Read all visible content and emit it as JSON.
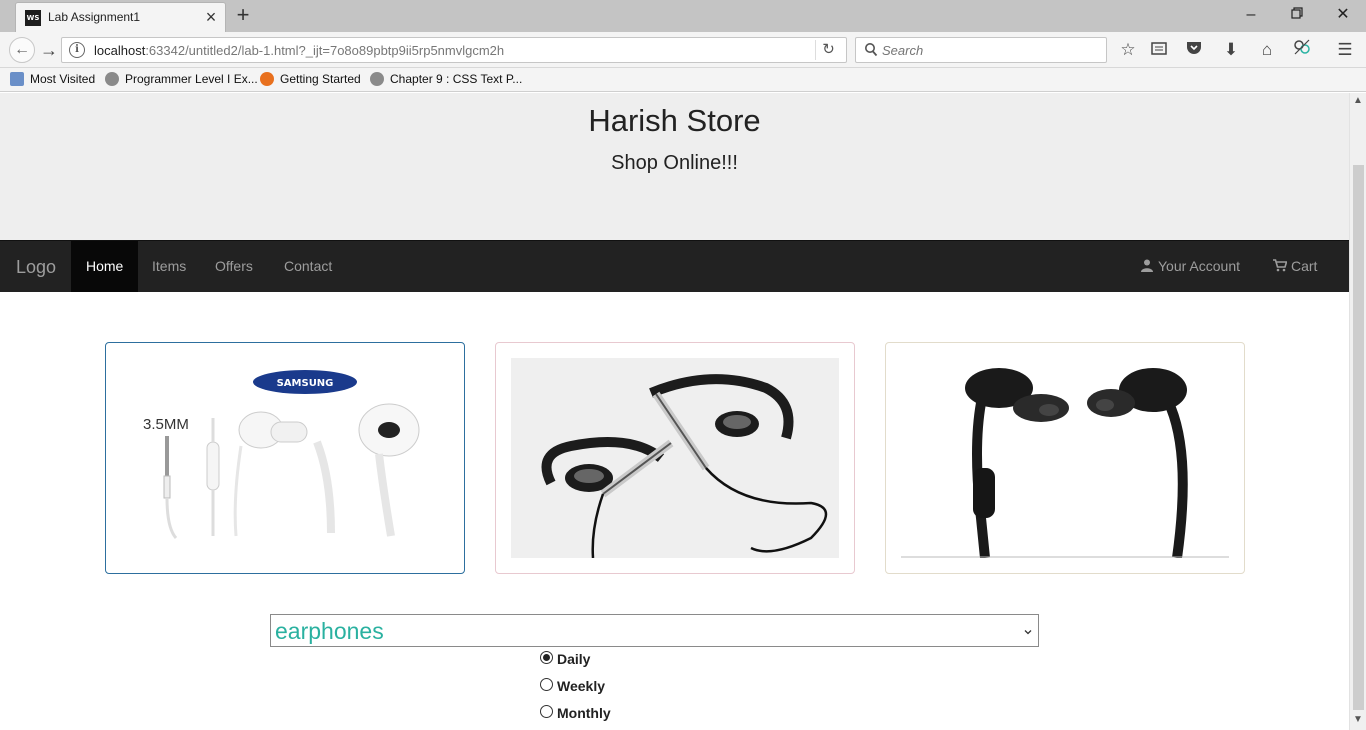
{
  "browser": {
    "tab_title": "Lab Assignment1",
    "tab_favicon_text": "WS",
    "url_host": "localhost",
    "url_rest": ":63342/untitled2/lab-1.html?_ijt=7o8o89pbtp9ii5rp5nmvlgcm2h",
    "search_placeholder": "Search",
    "bookmarks": [
      {
        "label": "Most Visited"
      },
      {
        "label": "Programmer Level I Ex..."
      },
      {
        "label": "Getting Started"
      },
      {
        "label": "Chapter 9 : CSS Text P..."
      }
    ]
  },
  "page": {
    "title": "Harish Store",
    "subtitle": "Shop Online!!!",
    "nav": {
      "logo": "Logo",
      "links": [
        {
          "label": "Home",
          "active": true
        },
        {
          "label": "Items"
        },
        {
          "label": "Offers"
        },
        {
          "label": "Contact"
        }
      ],
      "account_label": "Your Account",
      "cart_label": "Cart"
    },
    "products": [
      {
        "brand": "SAMSUNG",
        "caption": "3.5MM"
      },
      {
        "brand": ""
      },
      {
        "brand": ""
      }
    ],
    "category_select": {
      "selected": "earphones"
    },
    "frequency": {
      "options": [
        {
          "label": "Daily",
          "checked": true
        },
        {
          "label": "Weekly",
          "checked": false
        },
        {
          "label": "Monthly",
          "checked": false
        }
      ]
    }
  },
  "colors": {
    "jumbotron_bg": "#eeeeee",
    "navbar_bg": "#222222",
    "nav_active_bg": "#080808",
    "select_text": "#2ab1a0",
    "card1_border": "#2d6f9e",
    "card2_border": "#e8c9d0",
    "card3_border": "#e2dccb"
  }
}
